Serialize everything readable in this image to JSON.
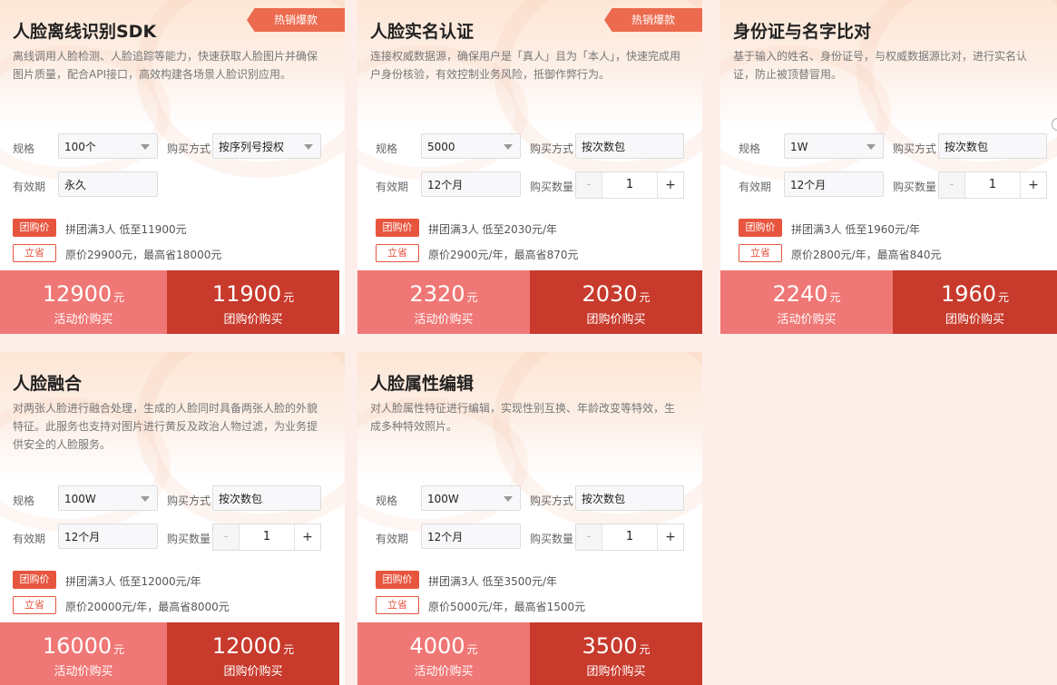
{
  "labels": {
    "spec": "规格",
    "validity": "有效期",
    "purchase_mode": "购买方式",
    "quantity": "购买数量",
    "group_tag": "团购价",
    "save_tag": "立省",
    "promo_buy": "活动价购买",
    "group_buy": "团购价购买",
    "yuan": "元",
    "minus": "-",
    "plus": "+"
  },
  "cards": [
    {
      "title": "人脸离线识别SDK",
      "badge": "热销爆款",
      "desc": "离线调用人脸检测、人脸追踪等能力，快速获取人脸图片并确保图片质量，配合API接口，高效构建各场景人脸识别应用。",
      "spec": "100个",
      "mode": "按序列号授权",
      "validity": "永久",
      "group_note": "拼团满3人 低至11900元",
      "orig_note": "原价29900元，最高省18000元",
      "promo_price": "12900",
      "group_price": "11900"
    },
    {
      "title": "人脸实名认证",
      "badge": "热销爆款",
      "desc": "连接权威数据源，确保用户是「真人」且为「本人」，快速完成用户身份核验，有效控制业务风险，抵御作弊行为。",
      "spec": "5000",
      "mode": "按次数包",
      "validity": "12个月",
      "quantity": "1",
      "group_note": "拼团满3人 低至2030元/年",
      "orig_note": "原价2900元/年，最高省870元",
      "promo_price": "2320",
      "group_price": "2030"
    },
    {
      "title": "身份证与名字比对",
      "desc": "基于输入的姓名、身份证号，与权威数据源比对，进行实名认证，防止被顶替冒用。",
      "spec": "1W",
      "mode": "按次数包",
      "validity": "12个月",
      "quantity": "1",
      "group_note": "拼团满3人 低至1960元/年",
      "orig_note": "原价2800元/年，最高省840元",
      "promo_price": "2240",
      "group_price": "1960"
    },
    {
      "title": "人脸融合",
      "desc": "对两张人脸进行融合处理，生成的人脸同时具备两张人脸的外貌特征。此服务也支持对图片进行黄反及政治人物过滤，为业务提供安全的人脸服务。",
      "spec": "100W",
      "mode": "按次数包",
      "validity": "12个月",
      "quantity": "1",
      "group_note": "拼团满3人 低至12000元/年",
      "orig_note": "原价20000元/年，最高省8000元",
      "promo_price": "16000",
      "group_price": "12000"
    },
    {
      "title": "人脸属性编辑",
      "desc": "对人脸属性特征进行编辑，实现性别互换、年龄改变等特效，生成多种特效照片。",
      "spec": "100W",
      "mode": "按次数包",
      "validity": "12个月",
      "quantity": "1",
      "group_note": "拼团满3人 低至3500元/年",
      "orig_note": "原价5000元/年，最高省1500元",
      "promo_price": "4000",
      "group_price": "3500"
    }
  ]
}
